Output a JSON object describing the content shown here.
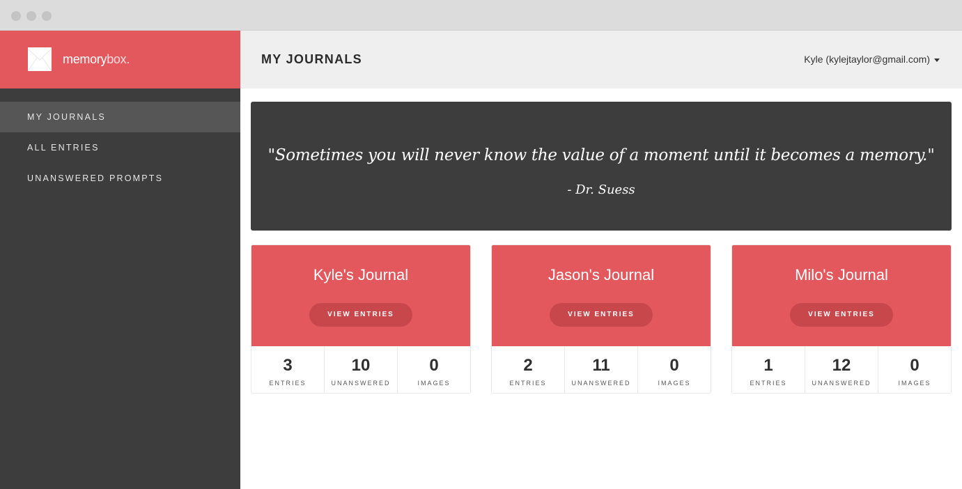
{
  "colors": {
    "accent": "#e3585c",
    "sidebar": "#3d3d3d",
    "header_bg": "#efefef"
  },
  "brand": {
    "name_prefix": "memory",
    "name_suffix": "box.",
    "logo_icon": "envelope-icon"
  },
  "sidebar": {
    "items": [
      {
        "label": "MY JOURNALS",
        "active": true
      },
      {
        "label": "ALL ENTRIES",
        "active": false
      },
      {
        "label": "UNANSWERED PROMPTS",
        "active": false
      }
    ]
  },
  "header": {
    "title": "MY JOURNALS",
    "user_menu": "Kyle (kylejtaylor@gmail.com)"
  },
  "quote": {
    "text": "\"Sometimes you will never know the value of a moment until it becomes a memory.\"",
    "author": "- Dr. Suess"
  },
  "journals": [
    {
      "title": "Kyle's Journal",
      "button": "VIEW ENTRIES",
      "stats": [
        {
          "value": "3",
          "label": "ENTRIES"
        },
        {
          "value": "10",
          "label": "UNANSWERED"
        },
        {
          "value": "0",
          "label": "IMAGES"
        }
      ]
    },
    {
      "title": "Jason's Journal",
      "button": "VIEW ENTRIES",
      "stats": [
        {
          "value": "2",
          "label": "ENTRIES"
        },
        {
          "value": "11",
          "label": "UNANSWERED"
        },
        {
          "value": "0",
          "label": "IMAGES"
        }
      ]
    },
    {
      "title": "Milo's Journal",
      "button": "VIEW ENTRIES",
      "stats": [
        {
          "value": "1",
          "label": "ENTRIES"
        },
        {
          "value": "12",
          "label": "UNANSWERED"
        },
        {
          "value": "0",
          "label": "IMAGES"
        }
      ]
    }
  ]
}
